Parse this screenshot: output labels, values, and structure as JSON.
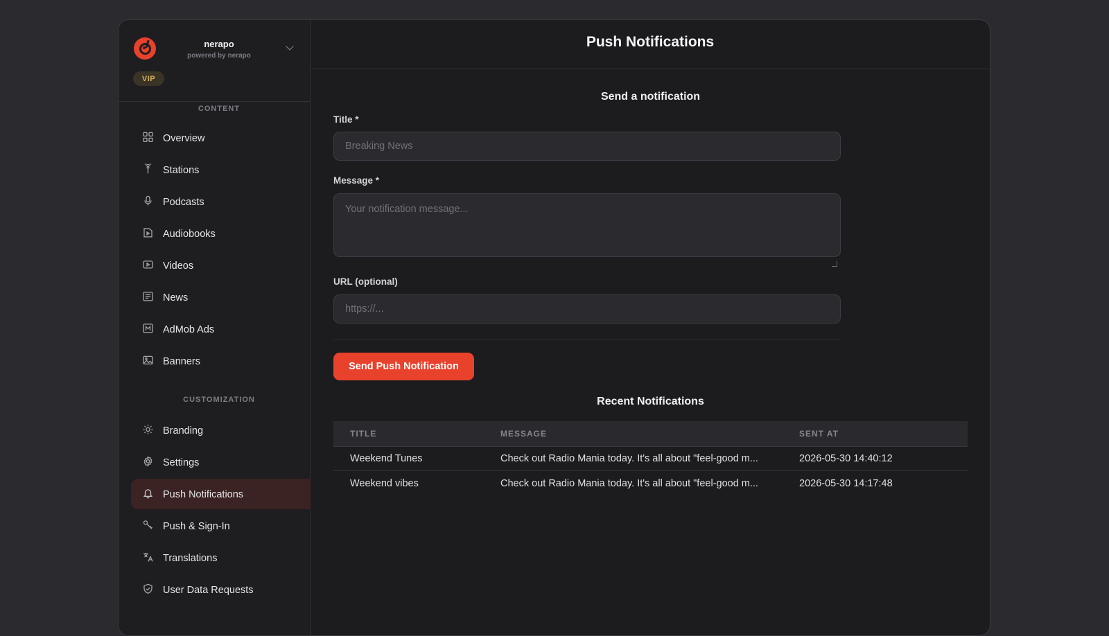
{
  "brand": {
    "name": "nerapo",
    "subtitle": "powered by nerapo",
    "badge": "VIP"
  },
  "sidebar": {
    "sections": [
      {
        "label": "CONTENT",
        "items": [
          {
            "label": "Overview",
            "icon": "grid-icon"
          },
          {
            "label": "Stations",
            "icon": "antenna-icon"
          },
          {
            "label": "Podcasts",
            "icon": "microphone-icon"
          },
          {
            "label": "Audiobooks",
            "icon": "book-play-icon"
          },
          {
            "label": "Videos",
            "icon": "video-icon"
          },
          {
            "label": "News",
            "icon": "newspaper-icon"
          },
          {
            "label": "AdMob Ads",
            "icon": "ad-icon"
          },
          {
            "label": "Banners",
            "icon": "image-icon"
          }
        ]
      },
      {
        "label": "CUSTOMIZATION",
        "items": [
          {
            "label": "Branding",
            "icon": "sun-icon"
          },
          {
            "label": "Settings",
            "icon": "gear-icon"
          },
          {
            "label": "Push Notifications",
            "icon": "bell-icon",
            "active": true
          },
          {
            "label": "Push & Sign-In",
            "icon": "key-icon"
          },
          {
            "label": "Translations",
            "icon": "translate-icon"
          },
          {
            "label": "User Data Requests",
            "icon": "shield-icon"
          }
        ]
      }
    ]
  },
  "page": {
    "title": "Push Notifications"
  },
  "form": {
    "section_title": "Send a notification",
    "title_label": "Title *",
    "title_placeholder": "Breaking News",
    "title_value": "",
    "message_label": "Message *",
    "message_placeholder": "Your notification message...",
    "message_value": "",
    "url_label": "URL (optional)",
    "url_placeholder": "https://...",
    "url_value": "",
    "submit_label": "Send Push Notification"
  },
  "recent": {
    "title": "Recent Notifications",
    "columns": [
      "TITLE",
      "MESSAGE",
      "SENT AT"
    ],
    "rows": [
      {
        "title": "Weekend Tunes",
        "message": "Check out Radio Mania today. It's all about \"feel-good m...",
        "sent_at": "2026-05-30 14:40:12"
      },
      {
        "title": "Weekend vibes",
        "message": "Check out Radio Mania today. It's all about \"feel-good m...",
        "sent_at": "2026-05-30 14:17:48"
      }
    ]
  },
  "colors": {
    "accent": "#e8412c",
    "active_bg": "#3a2322",
    "vip_text": "#d6b25a"
  }
}
